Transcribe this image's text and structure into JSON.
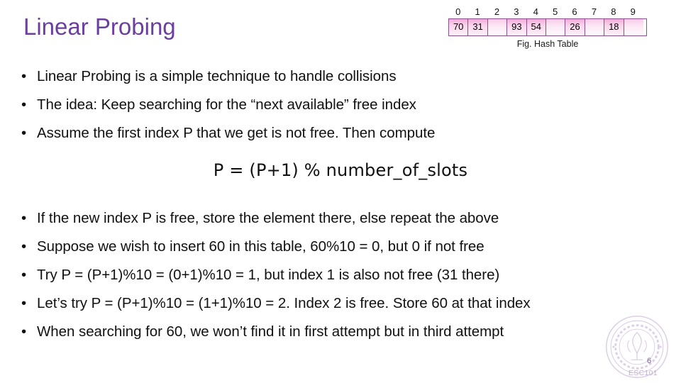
{
  "slide": {
    "title": "Linear Probing",
    "title_color": "#6b3fa0",
    "page_number": "6",
    "course_code": "ESC101",
    "logo_name": "iit-kanpur-logo"
  },
  "figure": {
    "caption": "Fig. Hash Table",
    "indices": [
      "0",
      "1",
      "2",
      "3",
      "4",
      "5",
      "6",
      "7",
      "8",
      "9"
    ],
    "cells": [
      "70",
      "31",
      "",
      "93",
      "54",
      "",
      "26",
      "",
      "18",
      ""
    ],
    "cell_border_color": "#8d4f8d",
    "cell_fill_color": "#f2a8d8"
  },
  "bullets_top": [
    {
      "marker": "•",
      "text": "Linear Probing is a simple technique to handle collisions"
    },
    {
      "marker": "•",
      "text": "The idea: Keep searching for the “next available” free index"
    },
    {
      "marker": "•",
      "text": "Assume the first index P that we get is not free. Then compute"
    }
  ],
  "formula": "P = (P+1) % number_of_slots",
  "bullets_bottom": [
    {
      "marker": "•",
      "text": "If the new index P is free, store the element there, else repeat the above"
    },
    {
      "marker": "•",
      "text": "Suppose we wish to insert 60 in this table, 60%10 = 0, but 0 if not free"
    },
    {
      "marker": "•",
      "text": "Try P = (P+1)%10 = (0+1)%10 = 1, but index 1 is also not free (31 there)"
    },
    {
      "marker": "•",
      "text": "Let’s try P = (P+1)%10 = (1+1)%10 = 2. Index 2 is free. Store 60 at that index"
    },
    {
      "marker": "•",
      "text": "When searching for 60, we won’t find it in first attempt but in third attempt"
    }
  ]
}
